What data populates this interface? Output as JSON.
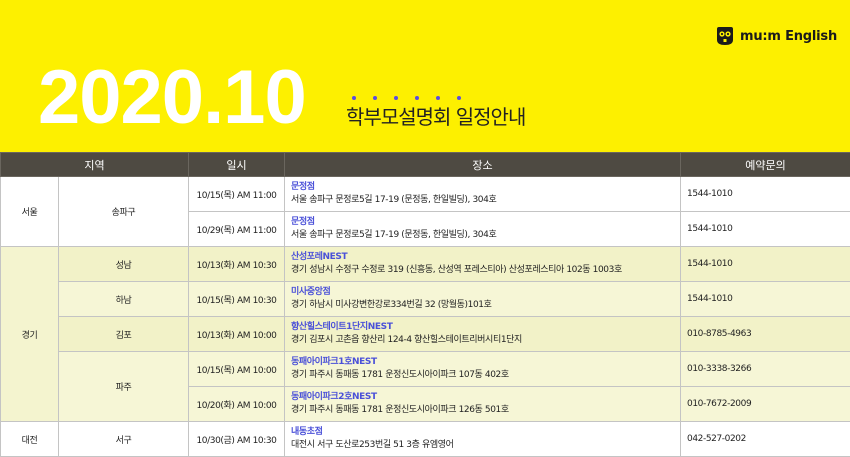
{
  "banner": {
    "logo_text": "mu:m English",
    "year": "2020.10",
    "subtitle": "학부모설명회 일정안내",
    "accent_color": "#fdf000",
    "dot_color": "#5b4de0"
  },
  "table": {
    "headers": {
      "region": "지역",
      "datetime": "일시",
      "place": "장소",
      "phone": "예약문의"
    },
    "regions": [
      "서울",
      "경기",
      "대전"
    ],
    "districts": [
      "송파구",
      "성남",
      "하남",
      "김포",
      "파주",
      "서구"
    ],
    "rows": [
      {
        "date": "10/15(목) AM 11:00",
        "name": "문정점",
        "address": "서울 송파구 문정로5길 17-19 (문정동, 한일빌딩), 304호",
        "phone": "1544-1010"
      },
      {
        "date": "10/29(목) AM 11:00",
        "name": "문정점",
        "address": "서울 송파구 문정로5길 17-19 (문정동, 한일빌딩), 304호",
        "phone": "1544-1010"
      },
      {
        "date": "10/13(화) AM 10:30",
        "name": "산성포레NEST",
        "address": "경기 성남시 수정구 수정로 319 (신흥동, 산성역 포레스티아) 산성포레스티아 102동 1003호",
        "phone": "1544-1010"
      },
      {
        "date": "10/15(목) AM 10:30",
        "name": "미사중앙점",
        "address": "경기 하남시 미사강변한강로334번길 32 (망월동)101호",
        "phone": "1544-1010"
      },
      {
        "date": "10/13(화) AM 10:00",
        "name": "향산힐스테이트1단지NEST",
        "address": "경기 김포시 고촌읍 향산리 124-4 향산힐스테이트리버시티1단지",
        "phone": "010-8785-4963"
      },
      {
        "date": "10/15(목) AM 10:00",
        "name": "동패아이파크1호NEST",
        "address": "경기 파주시 동패동 1781 운정신도시아이파크 107동 402호",
        "phone": "010-3338-3266"
      },
      {
        "date": "10/20(화) AM 10:00",
        "name": "동패아이파크2호NEST",
        "address": "경기 파주시 동패동 1781 운정신도시아이파크 126동 501호",
        "phone": "010-7672-2009"
      },
      {
        "date": "10/30(금) AM 10:30",
        "name": "내동초점",
        "address": "대전시 서구 도산로253번길 51 3층 유엠영어",
        "phone": "042-527-0202"
      }
    ]
  }
}
